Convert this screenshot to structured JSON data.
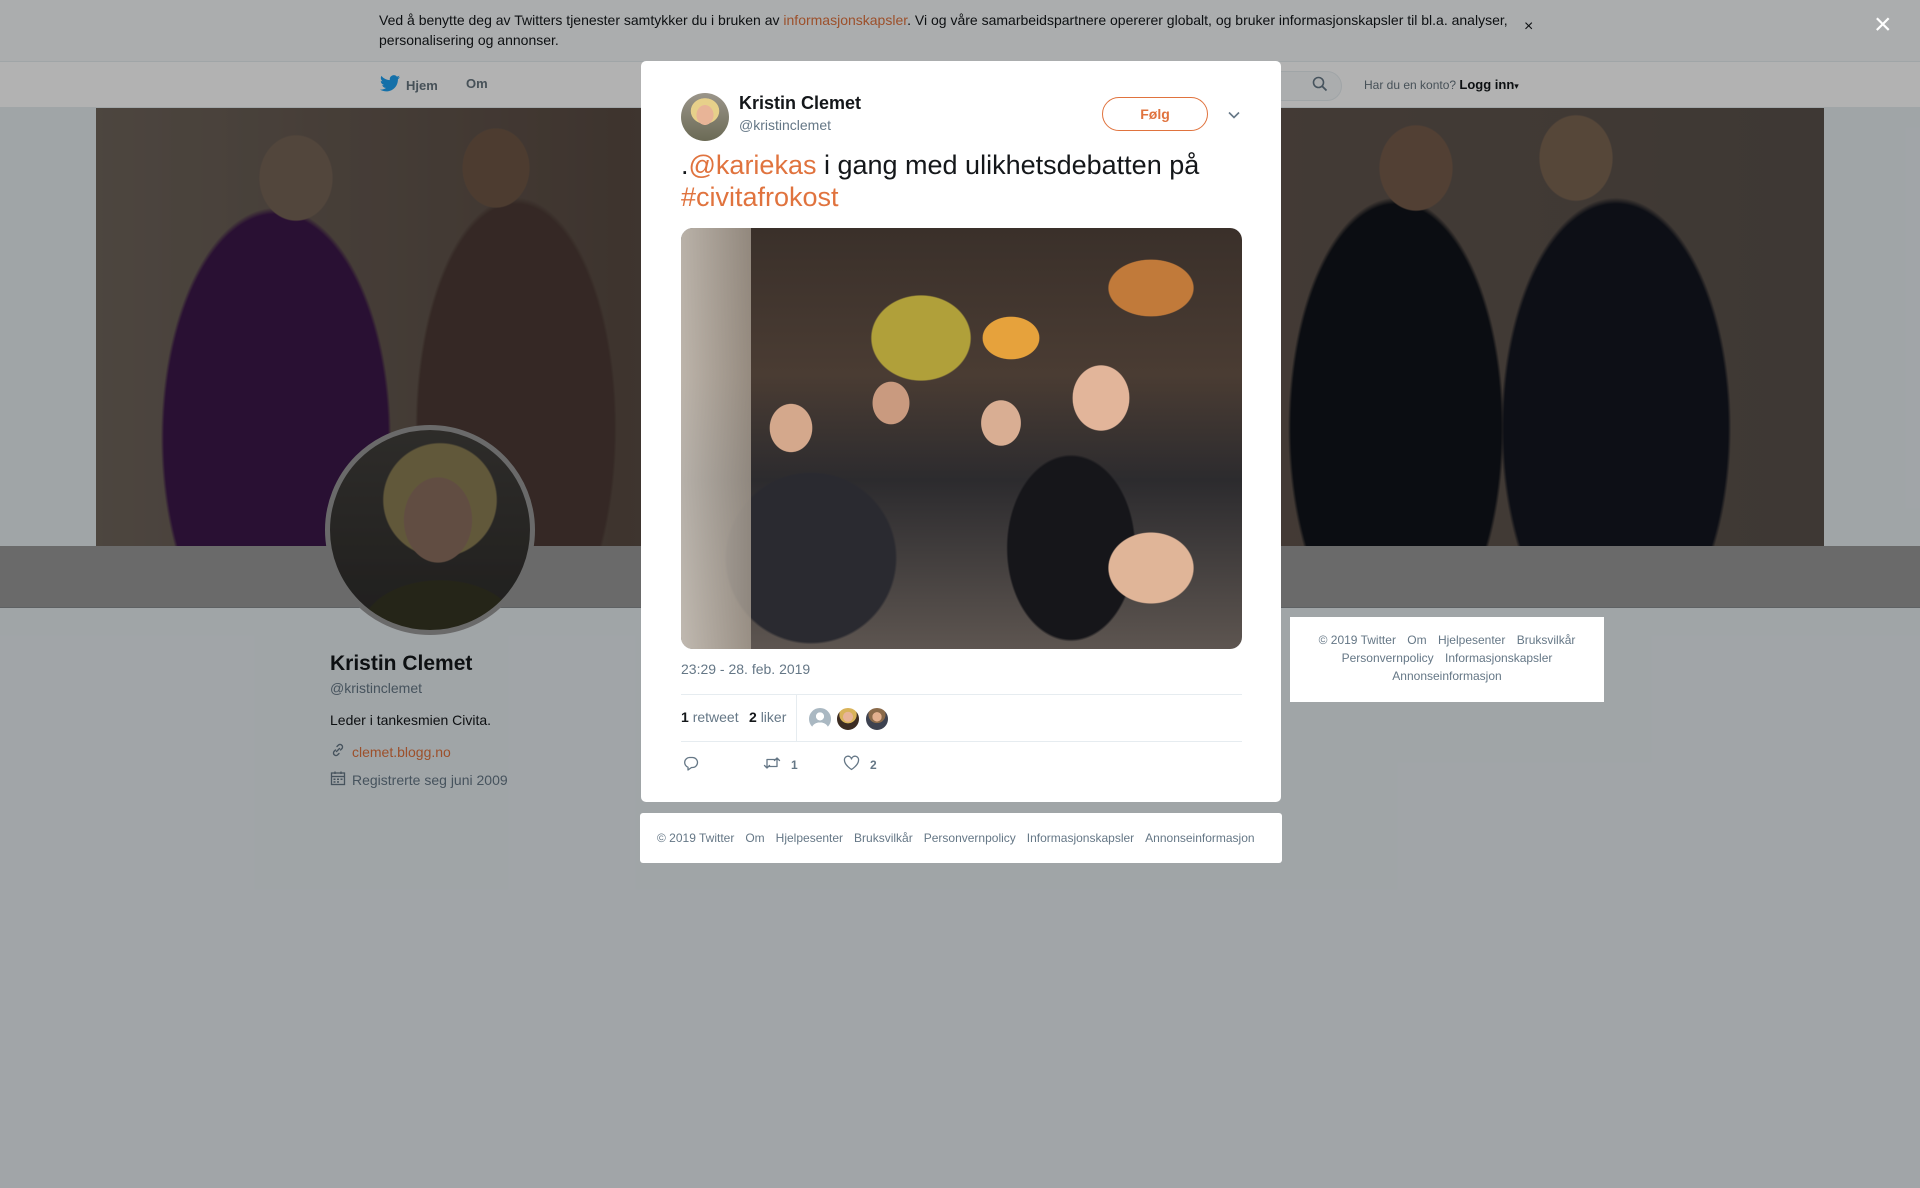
{
  "cookie_banner": {
    "text_before": "Ved å benytte deg av Twitters tjenester samtykker du i bruken av ",
    "link": "informasjonskapsler",
    "text_after": ". Vi og våre samarbeidspartnere opererer globalt, og bruker informasjonskapsler til bl.a. analyser, personalisering og annonser.",
    "close": "×"
  },
  "topnav": {
    "home": "Hjem",
    "about": "Om",
    "login_prompt": "Har du en konto?",
    "login": "Logg inn"
  },
  "profile": {
    "name": "Kristin Clemet",
    "handle": "@kristinclemet",
    "bio": "Leder i tankesmien Civita.",
    "website": "clemet.blogg.no",
    "joined": "Registrerte seg juni 2009"
  },
  "side_footer": {
    "items": [
      "© 2019 Twitter",
      "Om",
      "Hjelpesenter",
      "Bruksvilkår",
      "Personvernpolicy",
      "Informasjonskapsler",
      "Annonseinformasjon"
    ]
  },
  "overlay_close": "×",
  "tweet": {
    "author_name": "Kristin Clemet",
    "author_handle": "@kristinclemet",
    "follow_label": "Følg",
    "text_prefix": ".",
    "mention": "@kariekas",
    "text_middle": " i gang med ulikhetsdebatten på ",
    "hashtag": "#civitafrokost",
    "timestamp": "23:29 - 28. feb. 2019",
    "retweet_count": "1",
    "retweet_label": "retweet",
    "like_count": "2",
    "like_label": "liker",
    "action_retweet_count": "1",
    "action_like_count": "2"
  },
  "modal_footer": {
    "items": [
      "© 2019 Twitter",
      "Om",
      "Hjelpesenter",
      "Bruksvilkår",
      "Personvernpolicy",
      "Informasjonskapsler",
      "Annonseinformasjon"
    ]
  },
  "colors": {
    "accent": "#e0733e",
    "text": "#14171a",
    "muted": "#657786",
    "background": "#e6ecf0",
    "twitter_blue": "#1da1f2"
  }
}
